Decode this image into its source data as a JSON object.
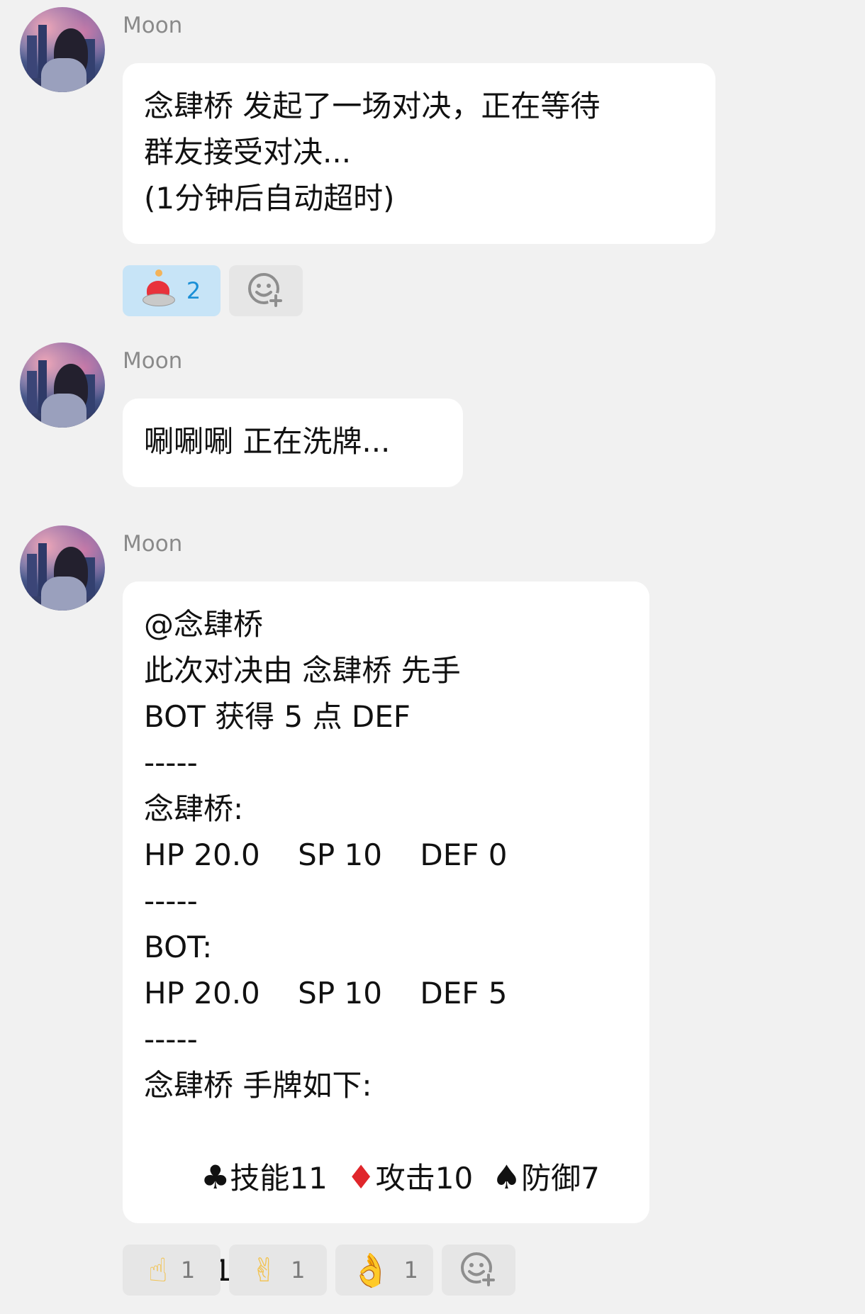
{
  "messages": [
    {
      "sender": "Moon",
      "lines": [
        "念肆桥 发起了一场对决，正在等待",
        "群友接受对决...",
        "(1分钟后自动超时)"
      ],
      "reactions": [
        {
          "icon": "red-button-emoji",
          "count": "2",
          "active": true
        },
        {
          "icon": "add-reaction-icon",
          "count": "",
          "active": false
        }
      ]
    },
    {
      "sender": "Moon",
      "lines": [
        "唰唰唰 正在洗牌..."
      ]
    },
    {
      "sender": "Moon",
      "lines": [
        "@念肆桥",
        "此次对决由 念肆桥 先手",
        "BOT 获得 5 点 DEF",
        "-----",
        "念肆桥:",
        "HP 20.0    SP 10    DEF 0",
        "-----",
        "BOT:",
        "HP 20.0    SP 10    DEF 5",
        "-----",
        "念肆桥 手牌如下:"
      ],
      "cards": [
        {
          "suit": "♣",
          "suit_icon": "club-icon",
          "label": "技能11"
        },
        {
          "suit": "♦",
          "suit_icon": "diamond-icon",
          "label": "攻击10"
        },
        {
          "suit": "♠",
          "suit_icon": "spade-icon",
          "label": "防御7"
        }
      ],
      "play_line": "出牌 1/2/3",
      "reactions": [
        {
          "icon": "point-up-hand-emoji",
          "glyph": "☝",
          "count": "1"
        },
        {
          "icon": "victory-hand-emoji",
          "glyph": "✌",
          "count": "1"
        },
        {
          "icon": "ok-hand-emoji",
          "glyph": "👌",
          "count": "1"
        },
        {
          "icon": "add-reaction-icon",
          "count": ""
        }
      ]
    }
  ],
  "colors": {
    "background": "#f1f1f1",
    "bubble": "#ffffff",
    "active_reaction": "#c7e4f7",
    "active_count": "#1a8fd6",
    "red_suit": "#e0262b"
  }
}
